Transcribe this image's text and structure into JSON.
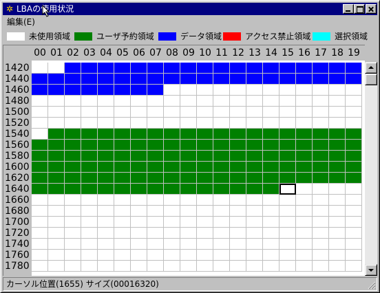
{
  "window": {
    "title": "LBAの使用状況",
    "icon": "gear-icon"
  },
  "menu": {
    "items": [
      {
        "label": "編集(E)"
      }
    ]
  },
  "legend": [
    {
      "label": "未使用領域",
      "color": "#ffffff"
    },
    {
      "label": "ユーザ予約領域",
      "color": "#008000"
    },
    {
      "label": "データ領域",
      "color": "#0000ff"
    },
    {
      "label": "アクセス禁止領域",
      "color": "#ff0000"
    },
    {
      "label": "選択領域",
      "color": "#00ffff"
    }
  ],
  "grid": {
    "columns": [
      "00",
      "01",
      "02",
      "03",
      "04",
      "05",
      "06",
      "07",
      "08",
      "09",
      "10",
      "11",
      "12",
      "13",
      "14",
      "15",
      "16",
      "17",
      "18",
      "19"
    ],
    "rows": [
      "1420",
      "1440",
      "1460",
      "1480",
      "1500",
      "1520",
      "1540",
      "1560",
      "1580",
      "1600",
      "1620",
      "1640",
      "1660",
      "1680",
      "1700",
      "1720",
      "1740",
      "1760",
      "1780"
    ],
    "cell_states": [
      "WWBBBBBBBBBBBBBBBBBB",
      "BBBBBBBBBBBBBBBBBBBB",
      "BBBBBBBBWWWWWWWWWWWW",
      "WWWWWWWWWWWWWWWWWWWW",
      "WWWWWWWWWWWWWWWWWWWW",
      "WWWWWWWWWWWWWWWWWWWW",
      "WGGGGGGGGGGGGGGGGGGG",
      "GGGGGGGGGGGGGGGGGGGG",
      "GGGGGGGGGGGGGGGGGGGG",
      "GGGGGGGGGGGGGGGGGGGG",
      "GGGGGGGGGGGGGGGGGGGG",
      "GGGGGGGGGGGGGGGCWWWW",
      "WWWWWWWWWWWWWWWWWWWW",
      "WWWWWWWWWWWWWWWWWWWW",
      "WWWWWWWWWWWWWWWWWWWW",
      "WWWWWWWWWWWWWWWWWWWW",
      "WWWWWWWWWWWWWWWWWWWW",
      "WWWWWWWWWWWWWWWWWWWW",
      "WWWWWWWWWWWWWWWWWWWW"
    ],
    "state_colors": {
      "W": "#ffffff",
      "G": "#008000",
      "B": "#0000ff",
      "R": "#ff0000",
      "S": "#00ffff",
      "C": "#ffffff"
    }
  },
  "status": {
    "text": "カーソル位置(1655)  サイズ(00016320)"
  }
}
